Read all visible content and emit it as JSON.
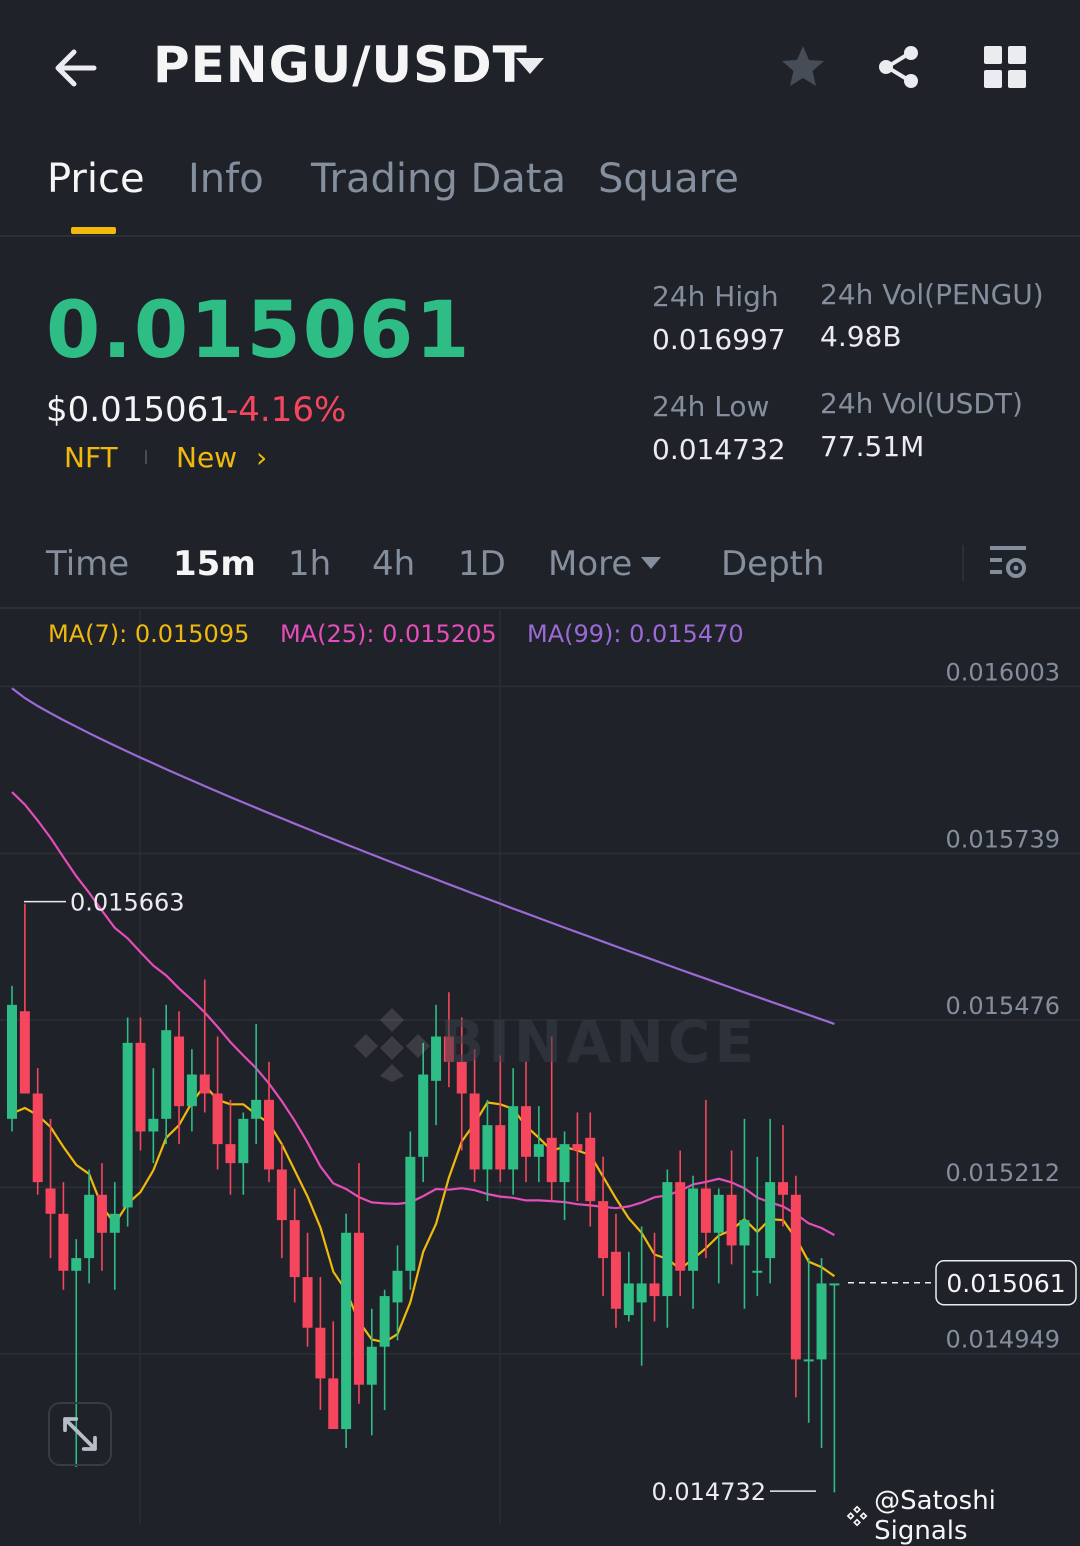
{
  "header": {
    "pair": "PENGU/USDT"
  },
  "tabs": [
    {
      "label": "Price",
      "active": true
    },
    {
      "label": "Info"
    },
    {
      "label": "Trading Data"
    },
    {
      "label": "Square"
    }
  ],
  "ticker": {
    "last_price": "0.015061",
    "usd_price": "$0.015061",
    "change": "-4.16%",
    "tags": [
      "NFT",
      "New"
    ],
    "stats": {
      "high_label": "24h High",
      "high": "0.016997",
      "low_label": "24h Low",
      "low": "0.014732",
      "vol_base_label": "24h Vol(PENGU)",
      "vol_base": "4.98B",
      "vol_quote_label": "24h Vol(USDT)",
      "vol_quote": "77.51M"
    }
  },
  "intervals": {
    "items": [
      "Time",
      "15m",
      "1h",
      "4h",
      "1D",
      "More",
      "Depth"
    ],
    "selected": "15m"
  },
  "ma_legend": {
    "ma7": "MA(7): 0.015095",
    "ma25": "MA(25): 0.015205",
    "ma99": "MA(99): 0.015470"
  },
  "colors": {
    "up": "#2ebd85",
    "down": "#f6465d",
    "accent": "#f0b90b",
    "ma7": "#f0b90b",
    "ma25": "#e44dba",
    "ma99": "#9b6ad6"
  },
  "watermark": "BINANCE",
  "credit": "@Satoshi Signals",
  "chart_data": {
    "type": "candlestick",
    "interval": "15m",
    "y_ticks": [
      "0.016003",
      "0.015739",
      "0.015476",
      "0.015212",
      "0.014949"
    ],
    "ylim": [
      0.01468,
      0.01607
    ],
    "last_price_label": "0.015061",
    "high_marker": "0.015663",
    "low_marker": "0.014732",
    "candles": [
      {
        "o": 0.01532,
        "h": 0.01553,
        "l": 0.0153,
        "c": 0.0155
      },
      {
        "o": 0.01549,
        "h": 0.01566,
        "l": 0.01544,
        "c": 0.01536
      },
      {
        "o": 0.01536,
        "h": 0.0154,
        "l": 0.0152,
        "c": 0.01522
      },
      {
        "o": 0.01521,
        "h": 0.01532,
        "l": 0.0151,
        "c": 0.01517
      },
      {
        "o": 0.01517,
        "h": 0.01522,
        "l": 0.01505,
        "c": 0.01508
      },
      {
        "o": 0.01508,
        "h": 0.01513,
        "l": 0.01477,
        "c": 0.0151
      },
      {
        "o": 0.0151,
        "h": 0.01524,
        "l": 0.01506,
        "c": 0.0152
      },
      {
        "o": 0.0152,
        "h": 0.01525,
        "l": 0.01508,
        "c": 0.01514
      },
      {
        "o": 0.01514,
        "h": 0.01522,
        "l": 0.01505,
        "c": 0.01517
      },
      {
        "o": 0.01518,
        "h": 0.01548,
        "l": 0.01515,
        "c": 0.01544
      },
      {
        "o": 0.01544,
        "h": 0.01548,
        "l": 0.01527,
        "c": 0.0153
      },
      {
        "o": 0.0153,
        "h": 0.0154,
        "l": 0.01525,
        "c": 0.01532
      },
      {
        "o": 0.01532,
        "h": 0.0155,
        "l": 0.01528,
        "c": 0.01546
      },
      {
        "o": 0.01545,
        "h": 0.01549,
        "l": 0.01528,
        "c": 0.01534
      },
      {
        "o": 0.01534,
        "h": 0.01543,
        "l": 0.0153,
        "c": 0.01539
      },
      {
        "o": 0.01539,
        "h": 0.01554,
        "l": 0.01533,
        "c": 0.01536
      },
      {
        "o": 0.01536,
        "h": 0.01545,
        "l": 0.01524,
        "c": 0.01528
      },
      {
        "o": 0.01528,
        "h": 0.01535,
        "l": 0.0152,
        "c": 0.01525
      },
      {
        "o": 0.01525,
        "h": 0.01533,
        "l": 0.0152,
        "c": 0.01532
      },
      {
        "o": 0.01532,
        "h": 0.01547,
        "l": 0.01528,
        "c": 0.01535
      },
      {
        "o": 0.01535,
        "h": 0.01541,
        "l": 0.01522,
        "c": 0.01524
      },
      {
        "o": 0.01524,
        "h": 0.01528,
        "l": 0.0151,
        "c": 0.01516
      },
      {
        "o": 0.01516,
        "h": 0.01521,
        "l": 0.01503,
        "c": 0.01507
      },
      {
        "o": 0.01507,
        "h": 0.01514,
        "l": 0.01496,
        "c": 0.01499
      },
      {
        "o": 0.01499,
        "h": 0.01507,
        "l": 0.01486,
        "c": 0.01491
      },
      {
        "o": 0.01491,
        "h": 0.015,
        "l": 0.01484,
        "c": 0.01483
      },
      {
        "o": 0.01483,
        "h": 0.01517,
        "l": 0.0148,
        "c": 0.01514
      },
      {
        "o": 0.01514,
        "h": 0.01525,
        "l": 0.01487,
        "c": 0.0149
      },
      {
        "o": 0.0149,
        "h": 0.01502,
        "l": 0.01482,
        "c": 0.01496
      },
      {
        "o": 0.01496,
        "h": 0.01505,
        "l": 0.01486,
        "c": 0.01504
      },
      {
        "o": 0.01503,
        "h": 0.01512,
        "l": 0.01497,
        "c": 0.01508
      },
      {
        "o": 0.01508,
        "h": 0.0153,
        "l": 0.01505,
        "c": 0.01526
      },
      {
        "o": 0.01526,
        "h": 0.01544,
        "l": 0.01522,
        "c": 0.01539
      },
      {
        "o": 0.01538,
        "h": 0.0155,
        "l": 0.01531,
        "c": 0.01545
      },
      {
        "o": 0.01545,
        "h": 0.01552,
        "l": 0.01537,
        "c": 0.01541
      },
      {
        "o": 0.01541,
        "h": 0.01548,
        "l": 0.01527,
        "c": 0.01536
      },
      {
        "o": 0.01536,
        "h": 0.01543,
        "l": 0.01522,
        "c": 0.01524
      },
      {
        "o": 0.01524,
        "h": 0.01535,
        "l": 0.01519,
        "c": 0.01531
      },
      {
        "o": 0.01531,
        "h": 0.01542,
        "l": 0.01522,
        "c": 0.01524
      },
      {
        "o": 0.01524,
        "h": 0.0154,
        "l": 0.0152,
        "c": 0.01534
      },
      {
        "o": 0.01534,
        "h": 0.01541,
        "l": 0.01522,
        "c": 0.01526
      },
      {
        "o": 0.01526,
        "h": 0.01534,
        "l": 0.01522,
        "c": 0.01528
      },
      {
        "o": 0.01529,
        "h": 0.01545,
        "l": 0.01519,
        "c": 0.01522
      },
      {
        "o": 0.01522,
        "h": 0.0153,
        "l": 0.01516,
        "c": 0.01528
      },
      {
        "o": 0.01528,
        "h": 0.01533,
        "l": 0.01519,
        "c": 0.01527
      },
      {
        "o": 0.01529,
        "h": 0.01533,
        "l": 0.01515,
        "c": 0.01519
      },
      {
        "o": 0.01519,
        "h": 0.01526,
        "l": 0.01504,
        "c": 0.0151
      },
      {
        "o": 0.01511,
        "h": 0.01517,
        "l": 0.01499,
        "c": 0.01502
      },
      {
        "o": 0.01501,
        "h": 0.01511,
        "l": 0.015,
        "c": 0.01506
      },
      {
        "o": 0.01503,
        "h": 0.01515,
        "l": 0.01493,
        "c": 0.01506
      },
      {
        "o": 0.01506,
        "h": 0.01514,
        "l": 0.015,
        "c": 0.01504
      },
      {
        "o": 0.01504,
        "h": 0.01524,
        "l": 0.01499,
        "c": 0.01522
      },
      {
        "o": 0.01522,
        "h": 0.01527,
        "l": 0.01504,
        "c": 0.01508
      },
      {
        "o": 0.01508,
        "h": 0.01523,
        "l": 0.01502,
        "c": 0.01521
      },
      {
        "o": 0.01521,
        "h": 0.01535,
        "l": 0.0151,
        "c": 0.01514
      },
      {
        "o": 0.01514,
        "h": 0.01521,
        "l": 0.01506,
        "c": 0.0152
      },
      {
        "o": 0.0152,
        "h": 0.01527,
        "l": 0.01509,
        "c": 0.01512
      },
      {
        "o": 0.01512,
        "h": 0.01532,
        "l": 0.01502,
        "c": 0.01516
      },
      {
        "o": 0.01508,
        "h": 0.01526,
        "l": 0.01504,
        "c": 0.01508
      },
      {
        "o": 0.0151,
        "h": 0.01532,
        "l": 0.01506,
        "c": 0.01522
      },
      {
        "o": 0.01522,
        "h": 0.01531,
        "l": 0.01515,
        "c": 0.0152
      },
      {
        "o": 0.0152,
        "h": 0.01523,
        "l": 0.01488,
        "c": 0.01494
      },
      {
        "o": 0.01494,
        "h": 0.0151,
        "l": 0.01484,
        "c": 0.01494
      },
      {
        "o": 0.01494,
        "h": 0.0151,
        "l": 0.0148,
        "c": 0.01506
      },
      {
        "o": 0.01506,
        "h": 0.01506,
        "l": 0.01473,
        "c": 0.01506
      }
    ]
  }
}
